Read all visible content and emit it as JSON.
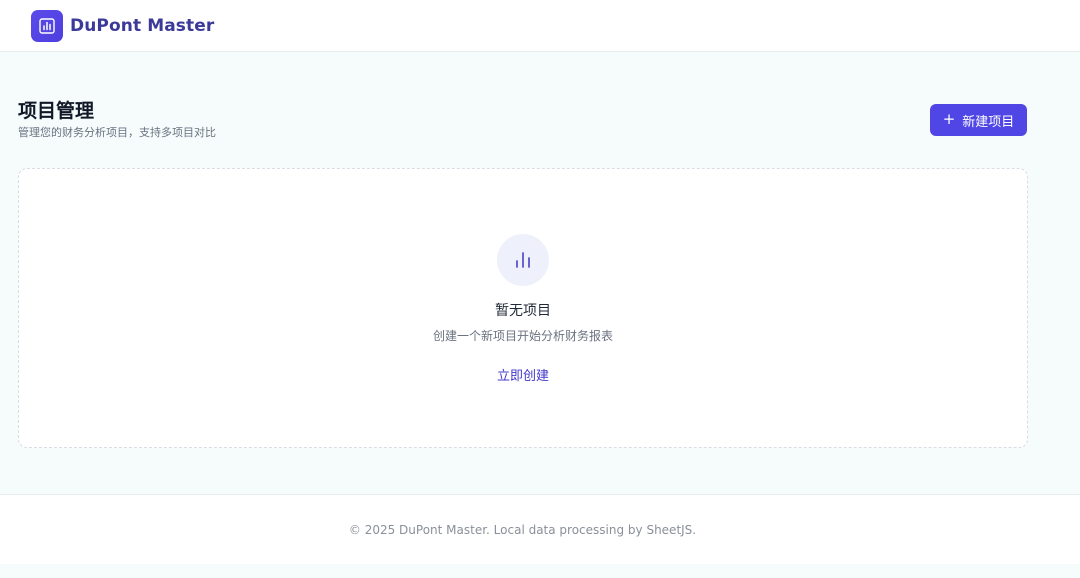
{
  "header": {
    "brand_name": "DuPont Master",
    "logo_icon": "bar-chart-icon"
  },
  "page": {
    "title": "项目管理",
    "subtitle": "管理您的财务分析项目，支持多项目对比",
    "new_button": {
      "icon": "plus-icon",
      "label": "新建项目"
    }
  },
  "empty_state": {
    "icon": "bar-chart-icon",
    "title": "暂无项目",
    "description": "创建一个新项目开始分析财务报表",
    "action_label": "立即创建"
  },
  "footer": {
    "text": "© 2025 DuPont Master. Local data processing by SheetJS."
  },
  "colors": {
    "accent": "#4f46e5",
    "brand_text": "#3c3a99",
    "link": "#4338ca",
    "background": "#f6fcfc"
  }
}
